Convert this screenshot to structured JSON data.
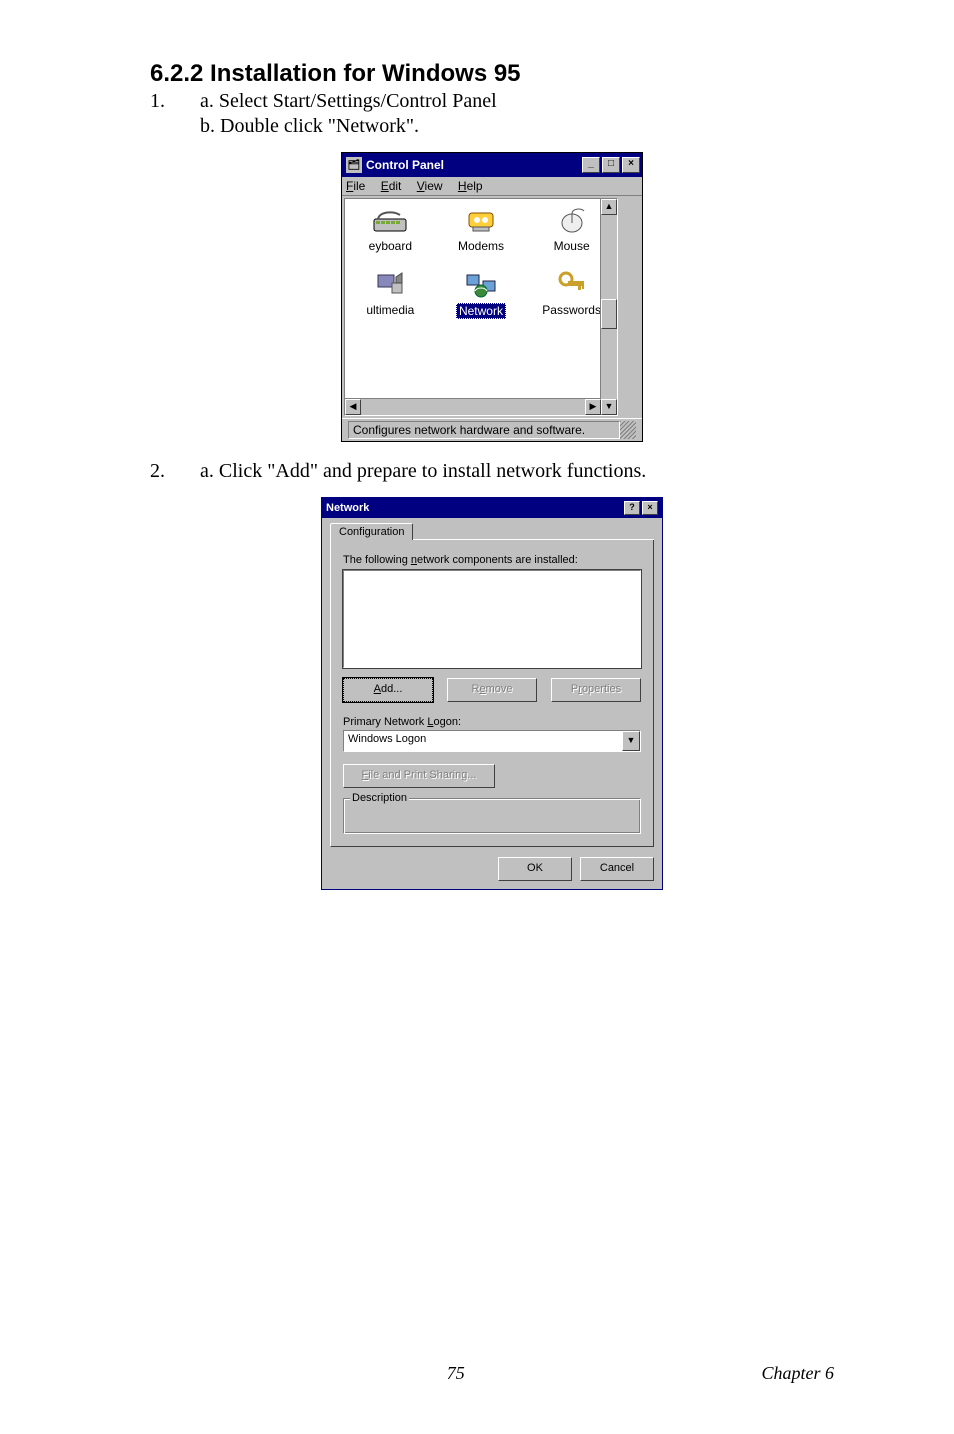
{
  "section": {
    "heading": "6.2.2 Installation for Windows 95",
    "step1_num": "1.",
    "step1a": "a. Select Start/Settings/Control Panel",
    "step1b": "b. Double click \"Network\".",
    "step2_num": "2.",
    "step2a": "a. Click \"Add\" and prepare to install network functions."
  },
  "cp": {
    "title": "Control Panel",
    "title_icon_glyph": "🗂",
    "min_glyph": "_",
    "max_glyph": "□",
    "close_glyph": "×",
    "menu": {
      "file": "File",
      "edit": "Edit",
      "view": "View",
      "help": "Help"
    },
    "icons": [
      {
        "label": "eyboard"
      },
      {
        "label": "Modems"
      },
      {
        "label": "Mouse"
      },
      {
        "label": "ultimedia"
      },
      {
        "label": "Network",
        "selected": true
      },
      {
        "label": "Passwords"
      }
    ],
    "scroll": {
      "up": "▲",
      "down": "▼",
      "left": "◀",
      "right": "▶"
    },
    "status": "Configures network hardware and software."
  },
  "net": {
    "title": "Network",
    "help_glyph": "?",
    "close_glyph": "×",
    "tab": "Configuration",
    "list_label": "The following network components are installed:",
    "add": "Add...",
    "remove": "Remove",
    "properties": "Properties",
    "logon_label": "Primary Network Logon:",
    "logon_value": "Windows Logon",
    "combo_glyph": "▼",
    "fps": "File and Print Sharing...",
    "desc_label": "Description",
    "ok": "OK",
    "cancel": "Cancel"
  },
  "footer": {
    "page": "75",
    "chapter": "Chapter 6"
  }
}
